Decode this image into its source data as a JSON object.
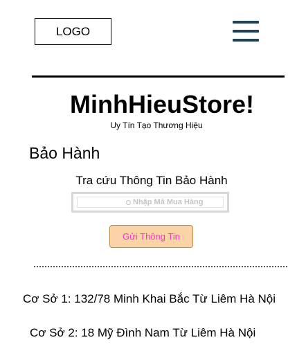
{
  "header": {
    "logo_text": "LOGO",
    "menu_icon": "hamburger-menu-icon"
  },
  "brand": {
    "title": "MinhHieuStore!",
    "slogan": "Uy Tín Tạo Thương Hiệu"
  },
  "warranty": {
    "heading": "Bảo Hành",
    "lookup_label": "Tra cứu Thông Tin Bảo Hành",
    "search_icon": "search-icon",
    "search_placeholder": "Nhập Mã Mua Hàng",
    "search_value": "",
    "submit_label": "Gửi Thông Tin"
  },
  "locations": [
    {
      "text": "Cơ Sở 1: 132/78 Minh Khai Bắc Từ Liêm Hà Nội"
    },
    {
      "text": "Cơ Sở 2: 18 Mỹ Đình Nam Từ Liêm Hà Nội"
    }
  ],
  "colors": {
    "menu_icon": "#1e4359",
    "button_bg": "#fbd3a9",
    "button_text": "#ff33cc",
    "button_border": "#c08b4a",
    "placeholder": "#c4c4c4"
  }
}
